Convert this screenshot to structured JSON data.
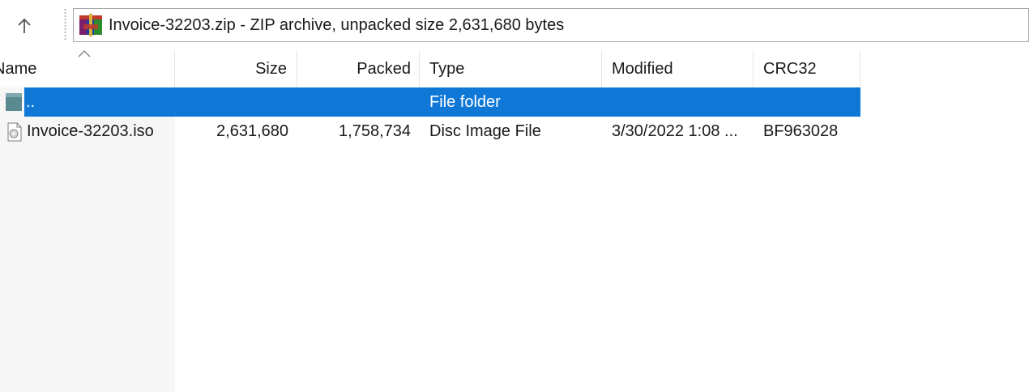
{
  "address": {
    "text": "Invoice-32203.zip - ZIP archive, unpacked size 2,631,680 bytes"
  },
  "icons": {
    "up": "arrow-up-icon",
    "archive": "winrar-archive-icon",
    "folder": "folder-icon",
    "file": "disc-image-file-icon",
    "sort": "sort-ascending-icon"
  },
  "columns": {
    "name": "Name",
    "size": "Size",
    "packed": "Packed",
    "type": "Type",
    "modified": "Modified",
    "crc": "CRC32"
  },
  "rows": [
    {
      "name": "..",
      "size": "",
      "packed": "",
      "type": "File folder",
      "modified": "",
      "crc": "",
      "selected": true
    },
    {
      "name": "Invoice-32203.iso",
      "size": "2,631,680",
      "packed": "1,758,734",
      "type": "Disc Image File",
      "modified": "3/30/2022 1:08 ...",
      "crc": "BF963028",
      "selected": false
    }
  ],
  "colors": {
    "selection": "#0f78d7",
    "selection_text": "#ffffff",
    "name_column_bg": "#f6f6f6"
  }
}
